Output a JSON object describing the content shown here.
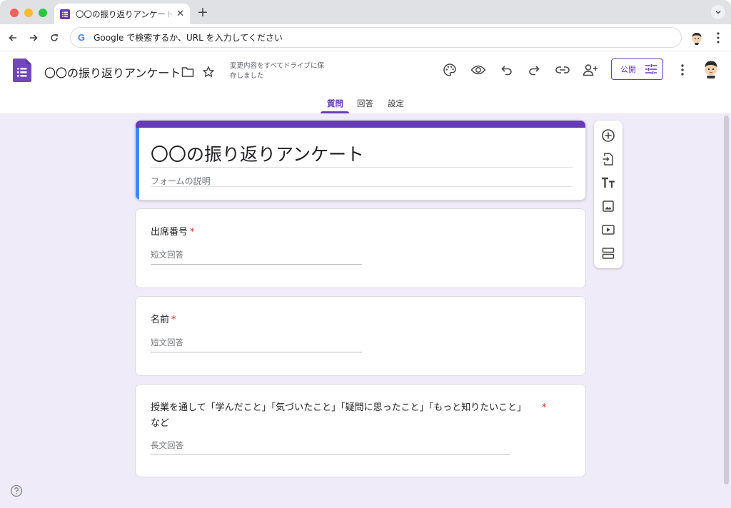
{
  "browser": {
    "tab_title": "〇〇の振り返りアンケート - Google Forms",
    "address_placeholder": "Google で検索するか、URL を入力してください",
    "omnibox_logo": "G"
  },
  "header": {
    "doc_title": "〇〇の振り返りアンケート",
    "save_status": "変更内容をすべてドライブに保存しました",
    "publish_label": "公開"
  },
  "tabs": [
    {
      "label": "質問",
      "active": true
    },
    {
      "label": "回答",
      "active": false
    },
    {
      "label": "設定",
      "active": false
    }
  ],
  "form": {
    "title": "〇〇の振り返りアンケート",
    "description_placeholder": "フォームの説明"
  },
  "questions": [
    {
      "label": "出席番号",
      "required_mark": "*",
      "answer_placeholder": "短文回答"
    },
    {
      "label": "名前",
      "required_mark": "*",
      "answer_placeholder": "短文回答"
    },
    {
      "label": "授業を通して「学んだこと」「気づいたこと」「疑問に思ったこと」「もっと知りたいこと」など",
      "required_mark": "*",
      "answer_placeholder": "長文回答"
    }
  ],
  "colors": {
    "accent": "#673ab7",
    "canvas_bg": "#f0ebf8",
    "title_left_bar": "#4285f4",
    "required": "#d93025"
  },
  "icons": {
    "header": [
      "palette-icon",
      "preview-eye-icon",
      "undo-icon",
      "redo-icon",
      "link-icon",
      "add-collaborator-icon",
      "more-vert-icon"
    ],
    "side_toolbar": [
      "add-question-icon",
      "import-questions-icon",
      "add-title-icon",
      "add-image-icon",
      "add-video-icon",
      "add-section-icon"
    ]
  }
}
